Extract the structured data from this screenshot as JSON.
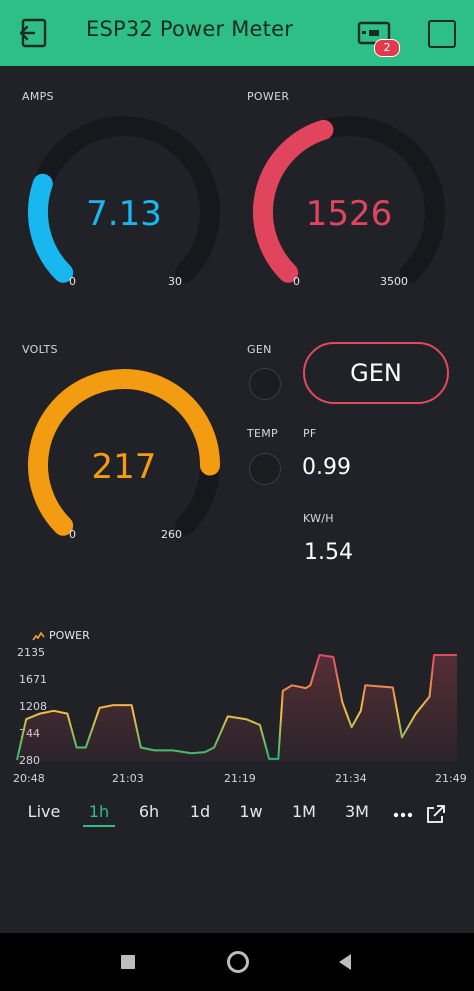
{
  "header": {
    "title": "ESP32 Power Meter",
    "badge_count": "2",
    "color": "#2ebf86",
    "icons": [
      "back-icon",
      "device-icon",
      "square-icon"
    ]
  },
  "widgets": {
    "amps": {
      "label": "AMPS",
      "value": 7.13,
      "display": "7.13",
      "min": 0,
      "max": 30,
      "min_label": "0",
      "max_label": "30",
      "color": "#18b7ef"
    },
    "power": {
      "label": "POWER",
      "value": 1526,
      "display": "1526",
      "min": 0,
      "max": 3500,
      "min_label": "0",
      "max_label": "3500",
      "color": "#e0455d"
    },
    "volts": {
      "label": "VOLTS",
      "value": 217,
      "display": "217",
      "min": 0,
      "max": 260,
      "min_label": "0",
      "max_label": "260",
      "color": "#f39c12"
    },
    "gen_led": {
      "label": "GEN",
      "state": "off"
    },
    "temp_led": {
      "label": "TEMP",
      "state": "off"
    },
    "gen_button": {
      "label": "GEN",
      "color": "#e04a5f"
    },
    "pf": {
      "label": "PF",
      "value": "0.99"
    },
    "kwh": {
      "label": "KW/H",
      "value": "1.54"
    }
  },
  "chart_data": {
    "type": "line",
    "series": [
      {
        "name": "POWER"
      }
    ],
    "legend_name": "POWER",
    "y_ticks": [
      "2135",
      "1671",
      "1208",
      "744",
      "280"
    ],
    "ylim": [
      280,
      2135
    ],
    "x_ticks": [
      "20:48",
      "21:03",
      "21:19",
      "21:34",
      "21:49"
    ],
    "points": [
      [
        0,
        280
      ],
      [
        1,
        1000
      ],
      [
        2.5,
        1100
      ],
      [
        4,
        1150
      ],
      [
        5.5,
        1100
      ],
      [
        6.5,
        500
      ],
      [
        7.5,
        500
      ],
      [
        9,
        1200
      ],
      [
        10.5,
        1250
      ],
      [
        12.5,
        1250
      ],
      [
        13.5,
        500
      ],
      [
        15,
        450
      ],
      [
        17,
        450
      ],
      [
        19,
        400
      ],
      [
        20.5,
        420
      ],
      [
        21.5,
        500
      ],
      [
        23,
        1050
      ],
      [
        25,
        1000
      ],
      [
        26.5,
        900
      ],
      [
        27.5,
        300
      ],
      [
        28.5,
        300
      ],
      [
        29,
        1500
      ],
      [
        30,
        1600
      ],
      [
        31.5,
        1550
      ],
      [
        32,
        1600
      ],
      [
        33,
        2135
      ],
      [
        34.5,
        2100
      ],
      [
        35.5,
        1300
      ],
      [
        36.5,
        860
      ],
      [
        37.5,
        1150
      ],
      [
        38,
        1600
      ],
      [
        39.5,
        1580
      ],
      [
        41,
        1560
      ],
      [
        42,
        680
      ],
      [
        43.5,
        1100
      ],
      [
        45,
        1400
      ],
      [
        45.5,
        2135
      ],
      [
        47,
        2135
      ],
      [
        48,
        2135
      ]
    ],
    "colors": {
      "low": "#27b874",
      "mid": "#f0c341",
      "high": "#e04a5f"
    }
  },
  "ranges": {
    "items": [
      "Live",
      "1h",
      "6h",
      "1d",
      "1w",
      "1M",
      "3M"
    ],
    "active": "1h",
    "more_icon": "more-icon",
    "expand_icon": "expand-icon"
  },
  "navbar": {
    "icons": [
      "square-nav-icon",
      "home-nav-icon",
      "back-nav-icon"
    ]
  }
}
